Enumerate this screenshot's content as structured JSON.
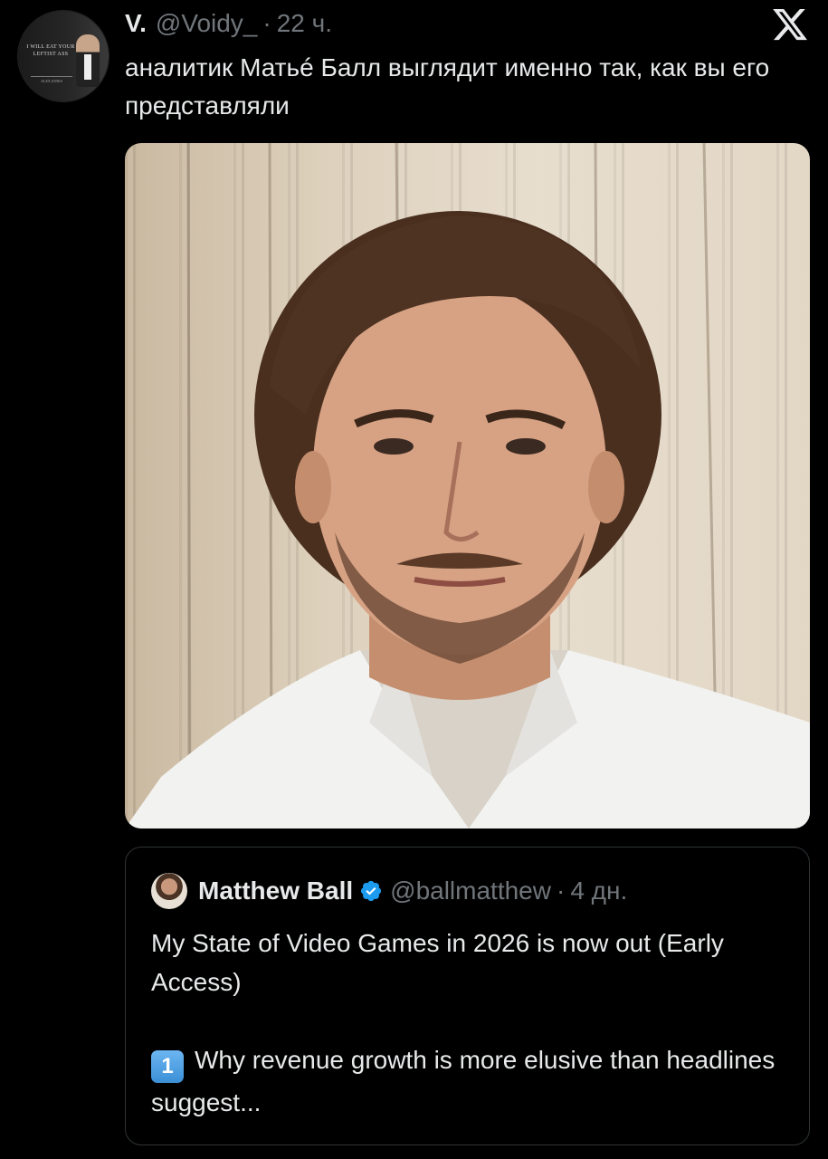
{
  "tweet": {
    "display_name": "V.",
    "handle": "@Voidy_",
    "separator": "·",
    "time": "22 ч.",
    "text": "аналитик Матьé Балл выглядит именно так, как вы его представляли",
    "avatar_text": "I WILL EAT YOUR LEFTIST ASS",
    "avatar_caption": "ALEX JONES"
  },
  "quoted": {
    "display_name": "Matthew Ball",
    "handle": "@ballmatthew",
    "separator": "·",
    "time": "4 дн.",
    "text_line1": "My State of Video Games in 2026 is now out (Early Access)",
    "keycap": "1",
    "text_line2": "Why revenue growth is more elusive than headlines suggest..."
  },
  "colors": {
    "background": "#000000",
    "text_primary": "#e7e9ea",
    "text_secondary": "#71767b",
    "border": "#2f3336",
    "verified": "#1d9bf0"
  },
  "icons": {
    "brand": "x-logo-icon",
    "verified": "verified-badge-icon",
    "keycap": "keycap-1-icon"
  }
}
